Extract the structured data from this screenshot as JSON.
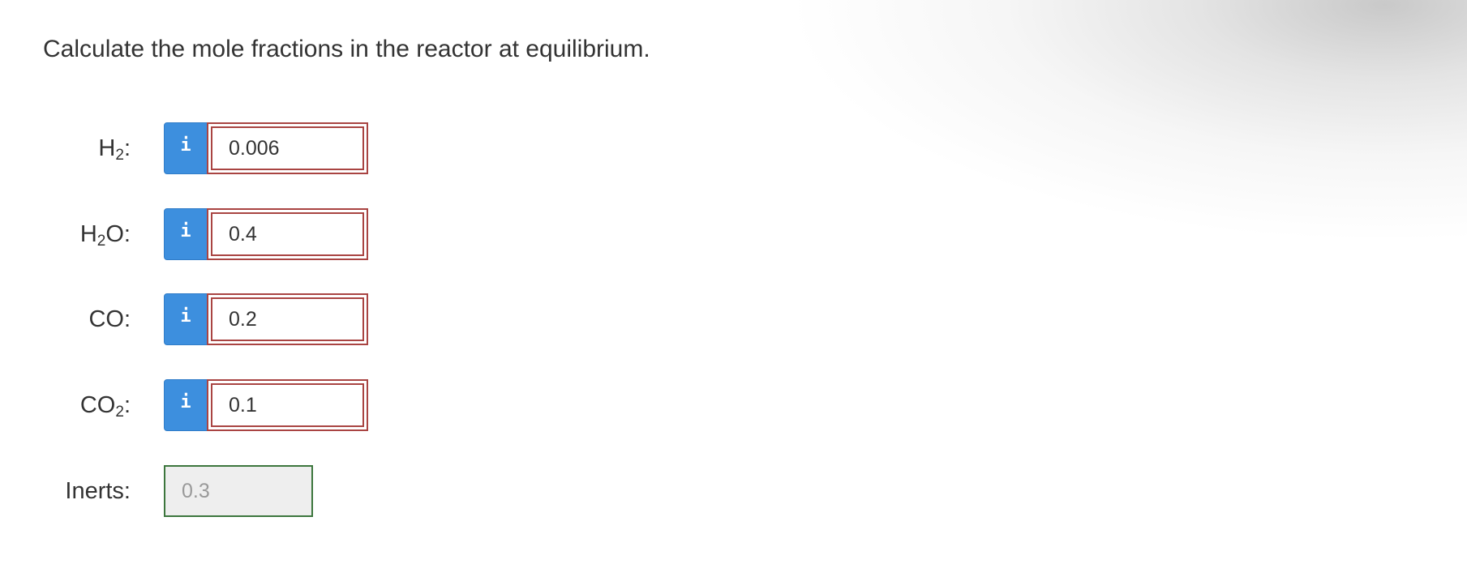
{
  "question": "Calculate the mole fractions in the reactor at equilibrium.",
  "info_button_label": "i",
  "fields": [
    {
      "label_main": "H",
      "label_sub": "2",
      "label_tail": ":",
      "value": "0.006"
    },
    {
      "label_main": "H",
      "label_sub": "2",
      "label_tail": "O:",
      "value": "0.4"
    },
    {
      "label_main": "CO:",
      "label_sub": "",
      "label_tail": "",
      "value": "0.2"
    },
    {
      "label_main": "CO",
      "label_sub": "2",
      "label_tail": ":",
      "value": "0.1"
    }
  ],
  "inerts": {
    "label": "Inerts:",
    "value": "0.3"
  },
  "colors": {
    "info_button": "#3d8fde",
    "incorrect_border": "#a94442",
    "correct_border": "#3c763d",
    "readonly_background": "#eeeeee"
  }
}
